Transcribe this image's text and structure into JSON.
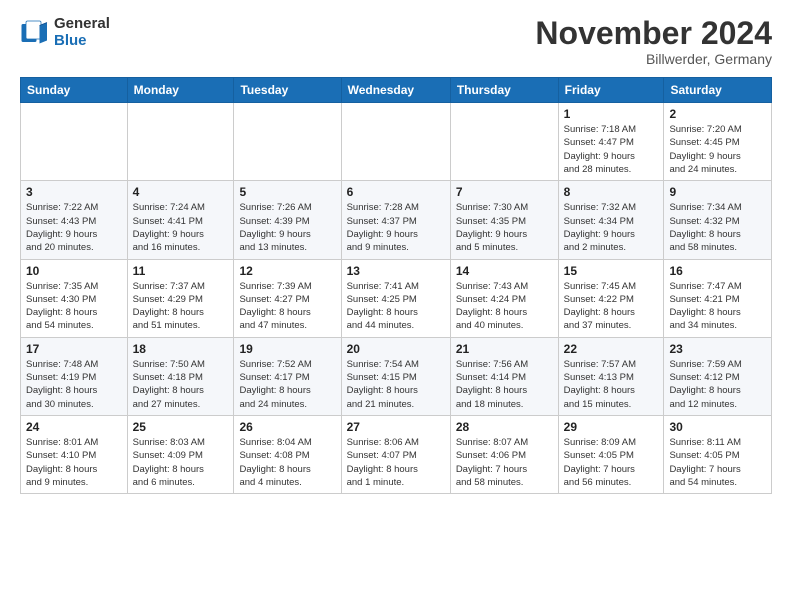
{
  "header": {
    "logo_general": "General",
    "logo_blue": "Blue",
    "month_title": "November 2024",
    "location": "Billwerder, Germany"
  },
  "days_of_week": [
    "Sunday",
    "Monday",
    "Tuesday",
    "Wednesday",
    "Thursday",
    "Friday",
    "Saturday"
  ],
  "weeks": [
    [
      {
        "day": "",
        "info": ""
      },
      {
        "day": "",
        "info": ""
      },
      {
        "day": "",
        "info": ""
      },
      {
        "day": "",
        "info": ""
      },
      {
        "day": "",
        "info": ""
      },
      {
        "day": "1",
        "info": "Sunrise: 7:18 AM\nSunset: 4:47 PM\nDaylight: 9 hours\nand 28 minutes."
      },
      {
        "day": "2",
        "info": "Sunrise: 7:20 AM\nSunset: 4:45 PM\nDaylight: 9 hours\nand 24 minutes."
      }
    ],
    [
      {
        "day": "3",
        "info": "Sunrise: 7:22 AM\nSunset: 4:43 PM\nDaylight: 9 hours\nand 20 minutes."
      },
      {
        "day": "4",
        "info": "Sunrise: 7:24 AM\nSunset: 4:41 PM\nDaylight: 9 hours\nand 16 minutes."
      },
      {
        "day": "5",
        "info": "Sunrise: 7:26 AM\nSunset: 4:39 PM\nDaylight: 9 hours\nand 13 minutes."
      },
      {
        "day": "6",
        "info": "Sunrise: 7:28 AM\nSunset: 4:37 PM\nDaylight: 9 hours\nand 9 minutes."
      },
      {
        "day": "7",
        "info": "Sunrise: 7:30 AM\nSunset: 4:35 PM\nDaylight: 9 hours\nand 5 minutes."
      },
      {
        "day": "8",
        "info": "Sunrise: 7:32 AM\nSunset: 4:34 PM\nDaylight: 9 hours\nand 2 minutes."
      },
      {
        "day": "9",
        "info": "Sunrise: 7:34 AM\nSunset: 4:32 PM\nDaylight: 8 hours\nand 58 minutes."
      }
    ],
    [
      {
        "day": "10",
        "info": "Sunrise: 7:35 AM\nSunset: 4:30 PM\nDaylight: 8 hours\nand 54 minutes."
      },
      {
        "day": "11",
        "info": "Sunrise: 7:37 AM\nSunset: 4:29 PM\nDaylight: 8 hours\nand 51 minutes."
      },
      {
        "day": "12",
        "info": "Sunrise: 7:39 AM\nSunset: 4:27 PM\nDaylight: 8 hours\nand 47 minutes."
      },
      {
        "day": "13",
        "info": "Sunrise: 7:41 AM\nSunset: 4:25 PM\nDaylight: 8 hours\nand 44 minutes."
      },
      {
        "day": "14",
        "info": "Sunrise: 7:43 AM\nSunset: 4:24 PM\nDaylight: 8 hours\nand 40 minutes."
      },
      {
        "day": "15",
        "info": "Sunrise: 7:45 AM\nSunset: 4:22 PM\nDaylight: 8 hours\nand 37 minutes."
      },
      {
        "day": "16",
        "info": "Sunrise: 7:47 AM\nSunset: 4:21 PM\nDaylight: 8 hours\nand 34 minutes."
      }
    ],
    [
      {
        "day": "17",
        "info": "Sunrise: 7:48 AM\nSunset: 4:19 PM\nDaylight: 8 hours\nand 30 minutes."
      },
      {
        "day": "18",
        "info": "Sunrise: 7:50 AM\nSunset: 4:18 PM\nDaylight: 8 hours\nand 27 minutes."
      },
      {
        "day": "19",
        "info": "Sunrise: 7:52 AM\nSunset: 4:17 PM\nDaylight: 8 hours\nand 24 minutes."
      },
      {
        "day": "20",
        "info": "Sunrise: 7:54 AM\nSunset: 4:15 PM\nDaylight: 8 hours\nand 21 minutes."
      },
      {
        "day": "21",
        "info": "Sunrise: 7:56 AM\nSunset: 4:14 PM\nDaylight: 8 hours\nand 18 minutes."
      },
      {
        "day": "22",
        "info": "Sunrise: 7:57 AM\nSunset: 4:13 PM\nDaylight: 8 hours\nand 15 minutes."
      },
      {
        "day": "23",
        "info": "Sunrise: 7:59 AM\nSunset: 4:12 PM\nDaylight: 8 hours\nand 12 minutes."
      }
    ],
    [
      {
        "day": "24",
        "info": "Sunrise: 8:01 AM\nSunset: 4:10 PM\nDaylight: 8 hours\nand 9 minutes."
      },
      {
        "day": "25",
        "info": "Sunrise: 8:03 AM\nSunset: 4:09 PM\nDaylight: 8 hours\nand 6 minutes."
      },
      {
        "day": "26",
        "info": "Sunrise: 8:04 AM\nSunset: 4:08 PM\nDaylight: 8 hours\nand 4 minutes."
      },
      {
        "day": "27",
        "info": "Sunrise: 8:06 AM\nSunset: 4:07 PM\nDaylight: 8 hours\nand 1 minute."
      },
      {
        "day": "28",
        "info": "Sunrise: 8:07 AM\nSunset: 4:06 PM\nDaylight: 7 hours\nand 58 minutes."
      },
      {
        "day": "29",
        "info": "Sunrise: 8:09 AM\nSunset: 4:05 PM\nDaylight: 7 hours\nand 56 minutes."
      },
      {
        "day": "30",
        "info": "Sunrise: 8:11 AM\nSunset: 4:05 PM\nDaylight: 7 hours\nand 54 minutes."
      }
    ]
  ]
}
